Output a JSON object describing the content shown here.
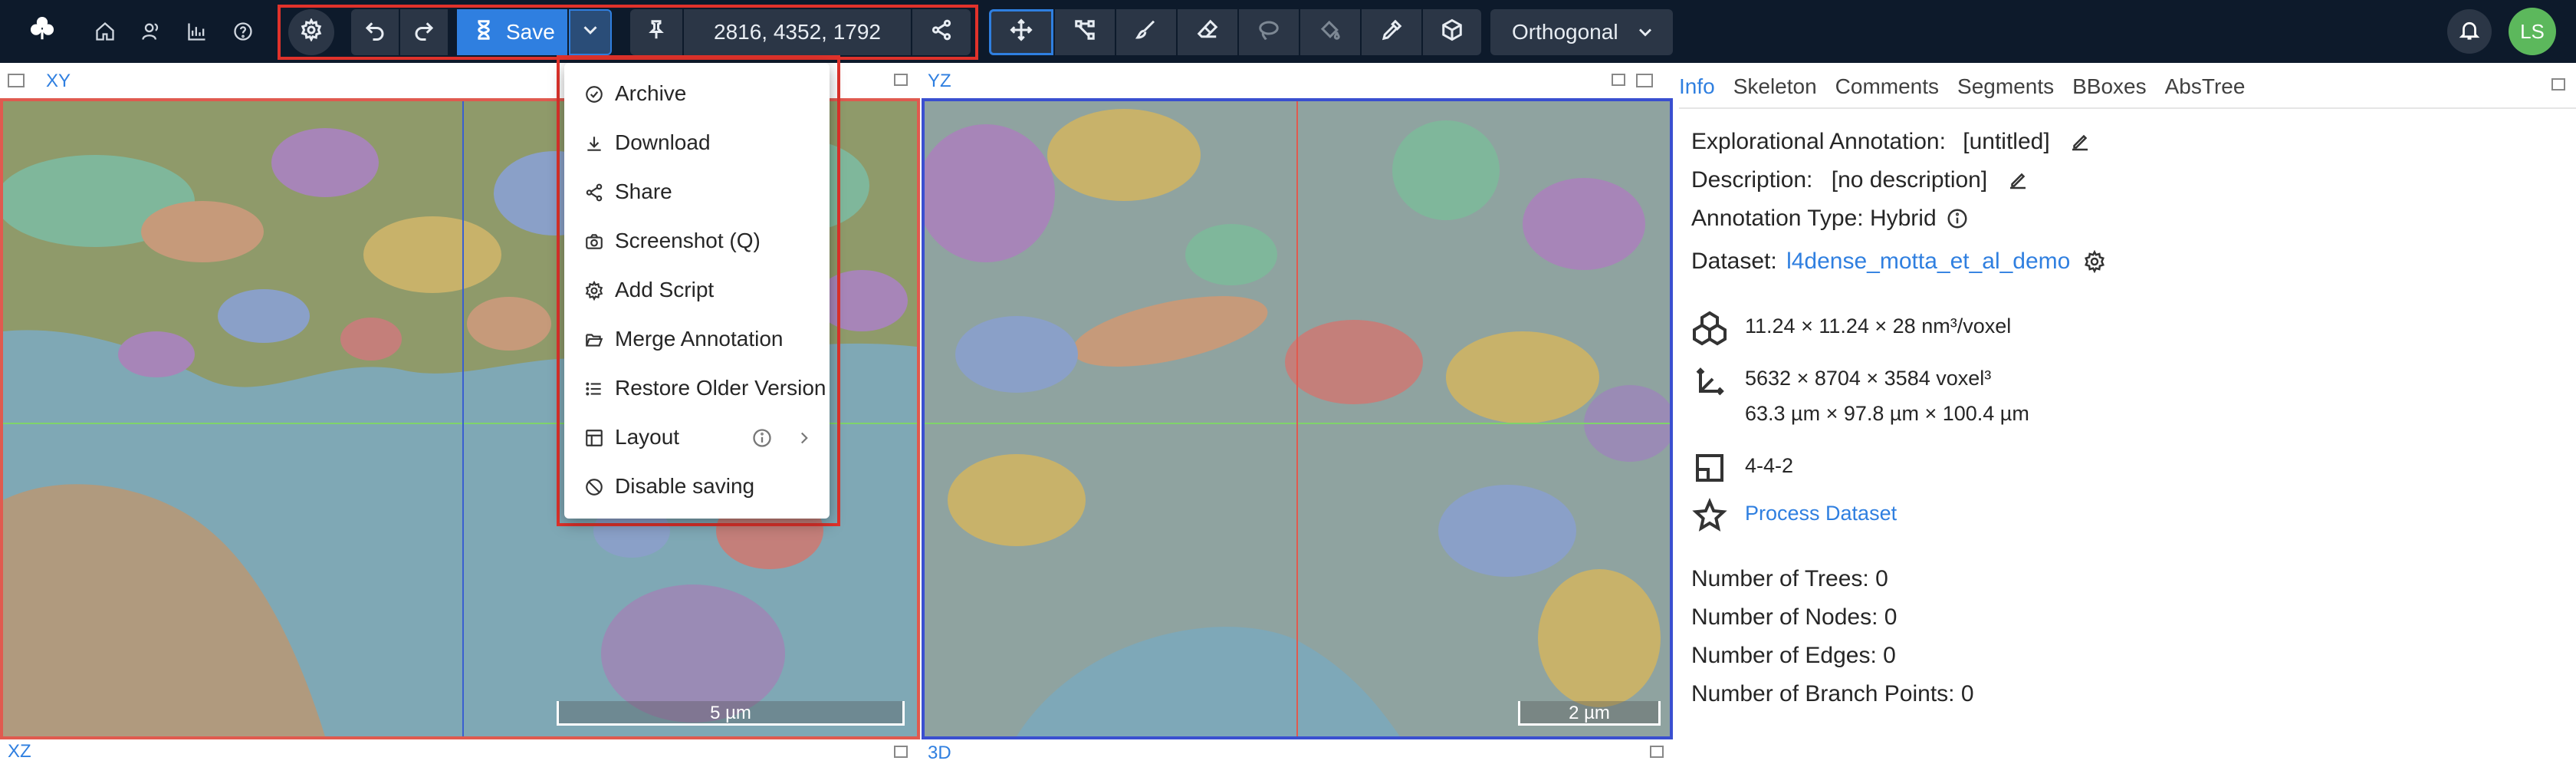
{
  "toolbar": {
    "save_label": "Save",
    "position": "2816, 4352, 1792",
    "view_mode": "Orthogonal",
    "user_initials": "LS"
  },
  "viewports": {
    "xy_label": "XY",
    "yz_label": "YZ",
    "xz_label": "XZ",
    "td_label": "3D",
    "xy_scale": "5 µm",
    "yz_scale": "2 µm"
  },
  "save_menu": {
    "items": [
      {
        "label": "Archive",
        "icon": "check-circle-icon"
      },
      {
        "label": "Download",
        "icon": "download-icon"
      },
      {
        "label": "Share",
        "icon": "share-icon"
      },
      {
        "label": "Screenshot (Q)",
        "icon": "camera-icon"
      },
      {
        "label": "Add Script",
        "icon": "gear-icon"
      },
      {
        "label": "Merge Annotation",
        "icon": "folder-open-icon"
      },
      {
        "label": "Restore Older Version",
        "icon": "list-icon"
      },
      {
        "label": "Layout",
        "icon": "layout-icon"
      },
      {
        "label": "Disable saving",
        "icon": "stop-icon"
      }
    ]
  },
  "panel": {
    "tabs": [
      "Info",
      "Skeleton",
      "Comments",
      "Segments",
      "BBoxes",
      "AbsTree"
    ],
    "annotation_label": "Explorational Annotation:",
    "annotation_name": "[untitled]",
    "description_label": "Description:",
    "description_value": "[no description]",
    "annotation_type": "Annotation Type: Hybrid",
    "dataset_label": "Dataset:",
    "dataset_name": "l4dense_motta_et_al_demo",
    "voxel_size": "11.24 × 11.24 × 28 nm³/voxel",
    "extent_voxels": "5632 × 8704 × 3584 voxel³",
    "extent_um": "63.3 µm × 97.8 µm × 100.4 µm",
    "mag": "4-4-2",
    "process_dataset": "Process Dataset",
    "trees": "Number of Trees: 0",
    "nodes": "Number of Nodes: 0",
    "edges": "Number of Edges: 0",
    "branch_points": "Number of Branch Points: 0"
  },
  "colors": {
    "navbar": "#0d1a2b",
    "accent": "#2f7fe0",
    "highlight": "#e0322b"
  }
}
